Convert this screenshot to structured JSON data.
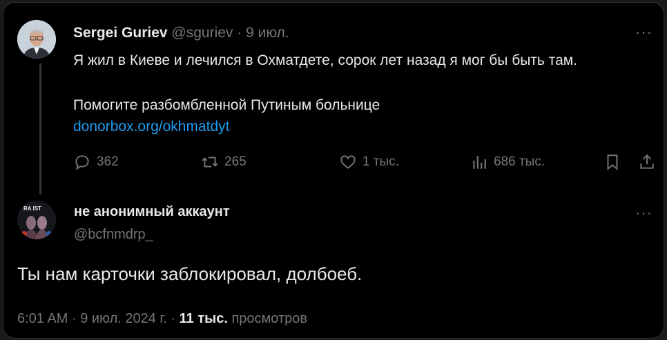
{
  "tweet": {
    "author_name": "Sergei Guriev",
    "author_handle": "@sguriev",
    "separator": "·",
    "date": "9 июл.",
    "more": "···",
    "text_line_1": "Я жил в Киеве и лечился в Охматдете, сорок лет назад я мог бы быть там.",
    "text_line_2": "Помогите разбомбленной Путиным больнице",
    "link": "donorbox.org/okhmatdyt",
    "replies": "362",
    "retweets": "265",
    "likes": "1 тыс.",
    "views": "686 тыс."
  },
  "reply": {
    "author_name": "не анонимный аккаунт",
    "author_handle": "@bcfnmdrp_",
    "more": "···",
    "avatar_text": "RA IST",
    "text": "Ты нам карточки заблокировал, долбоеб.",
    "time": "6:01 AM",
    "date": "9 июл. 2024 г.",
    "views_count": "11 тыс.",
    "views_label": "просмотров",
    "separator": "·"
  },
  "colors": {
    "background": "#000000",
    "text": "#e7e9ea",
    "muted": "#71767b",
    "link": "#1d9bf0",
    "thread_line": "#333639"
  },
  "icons": [
    "reply-icon",
    "retweet-icon",
    "like-icon",
    "views-icon",
    "bookmark-icon",
    "share-icon"
  ]
}
